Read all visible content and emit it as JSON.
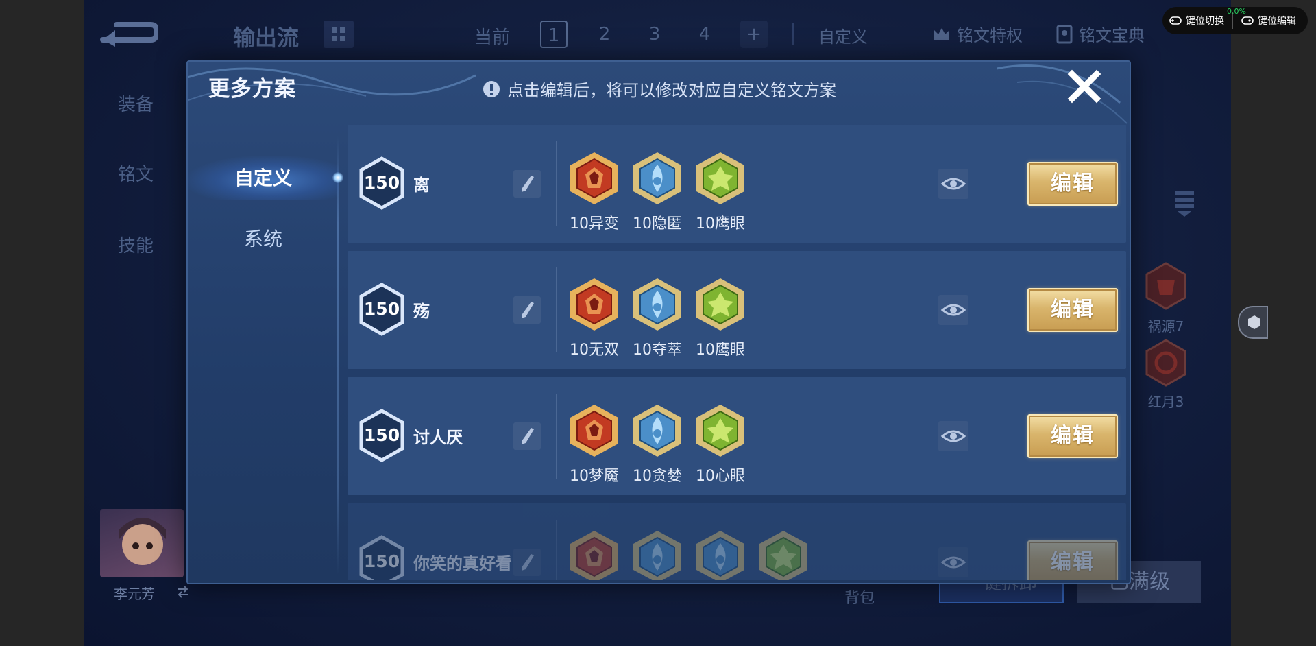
{
  "background": {
    "title": "输出流",
    "nav": {
      "current_label": "当前",
      "pages": [
        "1",
        "2",
        "3",
        "4"
      ],
      "current_page": "1",
      "add_label": "+"
    },
    "top_buttons": {
      "custom": "自定义",
      "privilege": "铭文特权",
      "handbook": "铭文宝典"
    },
    "side_menu": [
      "装备",
      "铭文",
      "技能"
    ],
    "right_runes": [
      {
        "label": "祸源7"
      },
      {
        "label": "红月3"
      }
    ],
    "hero_name": "李元芳",
    "bottom": {
      "bag": "背包",
      "fast_buy": "一键拆卸",
      "max_level": "已满级"
    }
  },
  "modal": {
    "title": "更多方案",
    "hint": "点击编辑后，将可以修改对应自定义铭文方案",
    "tabs": {
      "custom": "自定义",
      "system": "系统"
    },
    "edit_label": "编辑",
    "plans": [
      {
        "level": "150",
        "name": "离",
        "runes": [
          {
            "label": "10异变",
            "color": "red"
          },
          {
            "label": "10隐匿",
            "color": "blue"
          },
          {
            "label": "10鹰眼",
            "color": "green"
          }
        ]
      },
      {
        "level": "150",
        "name": "殇",
        "runes": [
          {
            "label": "10无双",
            "color": "red"
          },
          {
            "label": "10夺萃",
            "color": "blue"
          },
          {
            "label": "10鹰眼",
            "color": "green"
          }
        ]
      },
      {
        "level": "150",
        "name": "讨人厌",
        "runes": [
          {
            "label": "10梦魇",
            "color": "red"
          },
          {
            "label": "10贪婪",
            "color": "blue"
          },
          {
            "label": "10心眼",
            "color": "green"
          }
        ]
      },
      {
        "level": "150",
        "name": "你笑的真好看",
        "runes": [
          {
            "label": "",
            "color": "red"
          },
          {
            "label": "",
            "color": "blue"
          },
          {
            "label": "",
            "color": "blue"
          },
          {
            "label": "",
            "color": "green"
          }
        ]
      }
    ]
  },
  "overlay": {
    "key_switch": "键位切换",
    "key_edit": "键位编辑",
    "fps_pct": "0.0%"
  },
  "colors": {
    "rune_red": "#c23a22",
    "rune_blue": "#4b8fc9",
    "rune_green": "#7fb431",
    "gold": "#d9b56c",
    "panel": "#2c4a79"
  }
}
